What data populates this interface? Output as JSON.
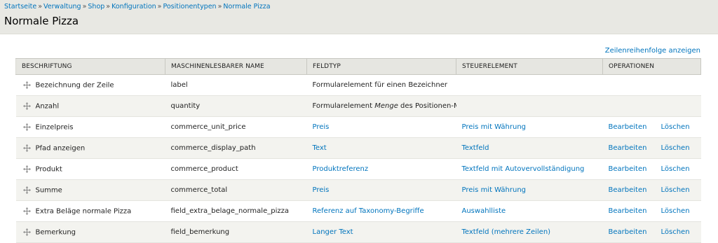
{
  "breadcrumb": [
    "Startseite",
    "Verwaltung",
    "Shop",
    "Konfiguration",
    "Positionentypen",
    "Normale Pizza"
  ],
  "page_title": "Normale Pizza",
  "row_weights_link": "Zeilenreihenfolge anzeigen",
  "table": {
    "headers": [
      "BESCHRIFTUNG",
      "MASCHINENLESBARER NAME",
      "FELDTYP",
      "STEUERELEMENT",
      "OPERATIONEN"
    ],
    "rows": [
      {
        "label": "Bezeichnung der Zeile",
        "machine": "label",
        "type": "Formularelement für einen Bezeichner",
        "widget": "",
        "edit": "",
        "delete": ""
      },
      {
        "label": "Anzahl",
        "machine": "quantity",
        "type_pre": "Formularelement ",
        "type_em": "Menge",
        "type_post": " des Positionen-Moduls",
        "widget": "",
        "edit": "",
        "delete": ""
      },
      {
        "label": "Einzelpreis",
        "machine": "commerce_unit_price",
        "type": "Preis",
        "widget": "Preis mit Währung",
        "edit": "Bearbeiten",
        "delete": "Löschen"
      },
      {
        "label": "Pfad anzeigen",
        "machine": "commerce_display_path",
        "type": "Text",
        "widget": "Textfeld",
        "edit": "Bearbeiten",
        "delete": "Löschen"
      },
      {
        "label": "Produkt",
        "machine": "commerce_product",
        "type": "Produktreferenz",
        "widget": "Textfeld mit Autovervollständigung",
        "edit": "Bearbeiten",
        "delete": "Löschen"
      },
      {
        "label": "Summe",
        "machine": "commerce_total",
        "type": "Preis",
        "widget": "Preis mit Währung",
        "edit": "Bearbeiten",
        "delete": "Löschen"
      },
      {
        "label": "Extra Beläge normale Pizza",
        "machine": "field_extra_belage_normale_pizza",
        "type": "Referenz auf Taxonomy-Begriffe",
        "widget": "Auswahlliste",
        "edit": "Bearbeiten",
        "delete": "Löschen"
      },
      {
        "label": "Bemerkung",
        "machine": "field_bemerkung",
        "type": "Langer Text",
        "widget": "Textfeld (mehrere Zeilen)",
        "edit": "Bearbeiten",
        "delete": "Löschen"
      }
    ]
  },
  "icons": {
    "drag": "drag-handle-icon"
  },
  "colors": {
    "link": "#0074bd",
    "header_bg": "#e8e8e3",
    "row_even": "#f3f3ef"
  }
}
